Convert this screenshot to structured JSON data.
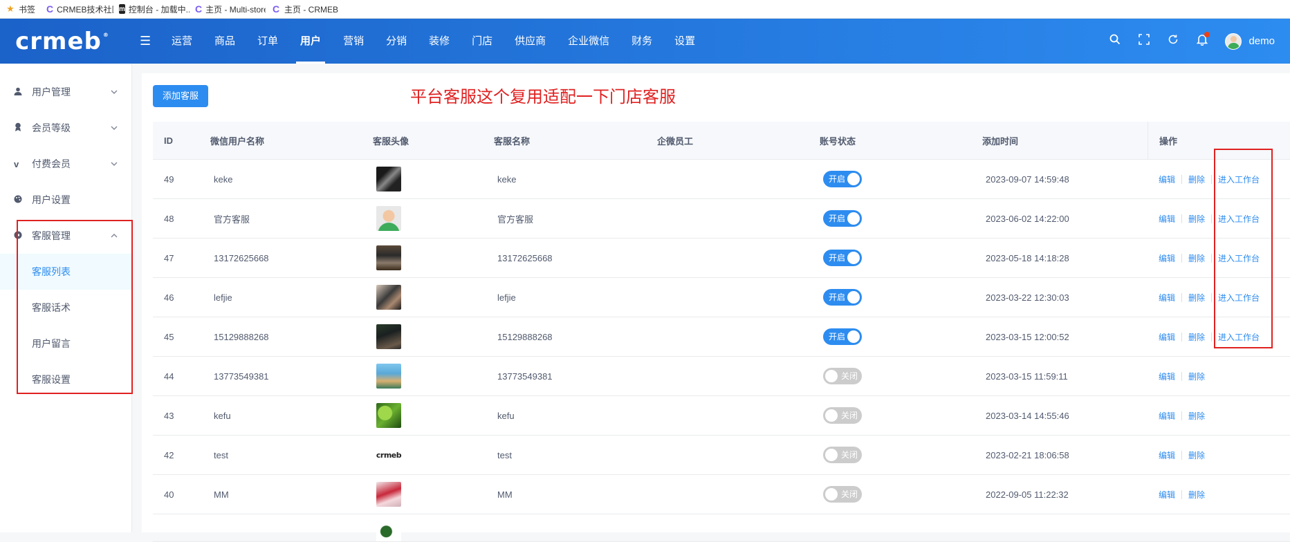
{
  "bookmarks": {
    "items": [
      {
        "icon": "star-icon",
        "label": "书签"
      },
      {
        "icon": "crmeb-c-icon",
        "label": "CRMEB技术社区|"
      },
      {
        "icon": "m-logo-icon",
        "label": "控制台 - 加载中..."
      },
      {
        "icon": "crmeb-c-icon",
        "label": "主页 - Multi-store"
      },
      {
        "icon": "crmeb-c-icon",
        "label": "主页 - CRMEB"
      }
    ]
  },
  "header": {
    "logo": "crmeb",
    "nav": [
      "运营",
      "商品",
      "订单",
      "用户",
      "营销",
      "分销",
      "装修",
      "门店",
      "供应商",
      "企业微信",
      "财务",
      "设置"
    ],
    "active_nav": "用户",
    "username": "demo"
  },
  "sidebar": {
    "groups": [
      {
        "label": "用户管理",
        "icon": "user-icon",
        "expanded": false
      },
      {
        "label": "会员等级",
        "icon": "member-icon",
        "expanded": false
      },
      {
        "label": "付费会员",
        "icon": "vip-icon",
        "expanded": false
      },
      {
        "label": "用户设置",
        "icon": "palette-icon",
        "expanded": false
      },
      {
        "label": "客服管理",
        "icon": "service-icon",
        "expanded": true
      }
    ],
    "sub_items": [
      "客服列表",
      "客服话术",
      "用户留言",
      "客服设置"
    ],
    "active_sub": "客服列表"
  },
  "main": {
    "add_button": "添加客服",
    "annotation": "平台客服这个复用适配一下门店客服",
    "columns": [
      "ID",
      "微信用户名称",
      "客服头像",
      "客服名称",
      "企微员工",
      "账号状态",
      "添加时间",
      "操作"
    ],
    "rows": [
      {
        "id": "49",
        "wx_name": "keke",
        "name": "keke",
        "staff": "",
        "status": "开启",
        "on": true,
        "time": "2023-09-07 14:59:48",
        "workbench": "进入工作台"
      },
      {
        "id": "48",
        "wx_name": "官方客服",
        "name": "官方客服",
        "staff": "",
        "status": "开启",
        "on": true,
        "time": "2023-06-02 14:22:00",
        "workbench": "进入工作台"
      },
      {
        "id": "47",
        "wx_name": "13172625668",
        "name": "13172625668",
        "staff": "",
        "status": "开启",
        "on": true,
        "time": "2023-05-18 14:18:28",
        "workbench": "进入工作台"
      },
      {
        "id": "46",
        "wx_name": "lefjie",
        "name": "lefjie",
        "staff": "",
        "status": "开启",
        "on": true,
        "time": "2023-03-22 12:30:03",
        "workbench": "进入工作台"
      },
      {
        "id": "45",
        "wx_name": "15129888268",
        "name": "15129888268",
        "staff": "",
        "status": "开启",
        "on": true,
        "time": "2023-03-15 12:00:52",
        "workbench": "进入工作台"
      },
      {
        "id": "44",
        "wx_name": "13773549381",
        "name": "13773549381",
        "staff": "",
        "status": "关闭",
        "on": false,
        "time": "2023-03-15 11:59:11",
        "workbench": ""
      },
      {
        "id": "43",
        "wx_name": "kefu",
        "name": "kefu",
        "staff": "",
        "status": "关闭",
        "on": false,
        "time": "2023-03-14 14:55:46",
        "workbench": ""
      },
      {
        "id": "42",
        "wx_name": "test",
        "name": "test",
        "staff": "",
        "status": "关闭",
        "on": false,
        "time": "2023-02-21 18:06:58",
        "workbench": "",
        "avatar_text": "crmeb"
      },
      {
        "id": "40",
        "wx_name": "MM",
        "name": "MM",
        "staff": "",
        "status": "关闭",
        "on": false,
        "time": "2022-09-05 11:22:32",
        "workbench": ""
      }
    ],
    "row_actions": {
      "edit": "编辑",
      "delete": "删除"
    }
  },
  "colors": {
    "primary": "#2d8cf0",
    "header_start": "#1b62c9",
    "annotation_red": "#e02020",
    "switch_off": "#cccccc"
  }
}
